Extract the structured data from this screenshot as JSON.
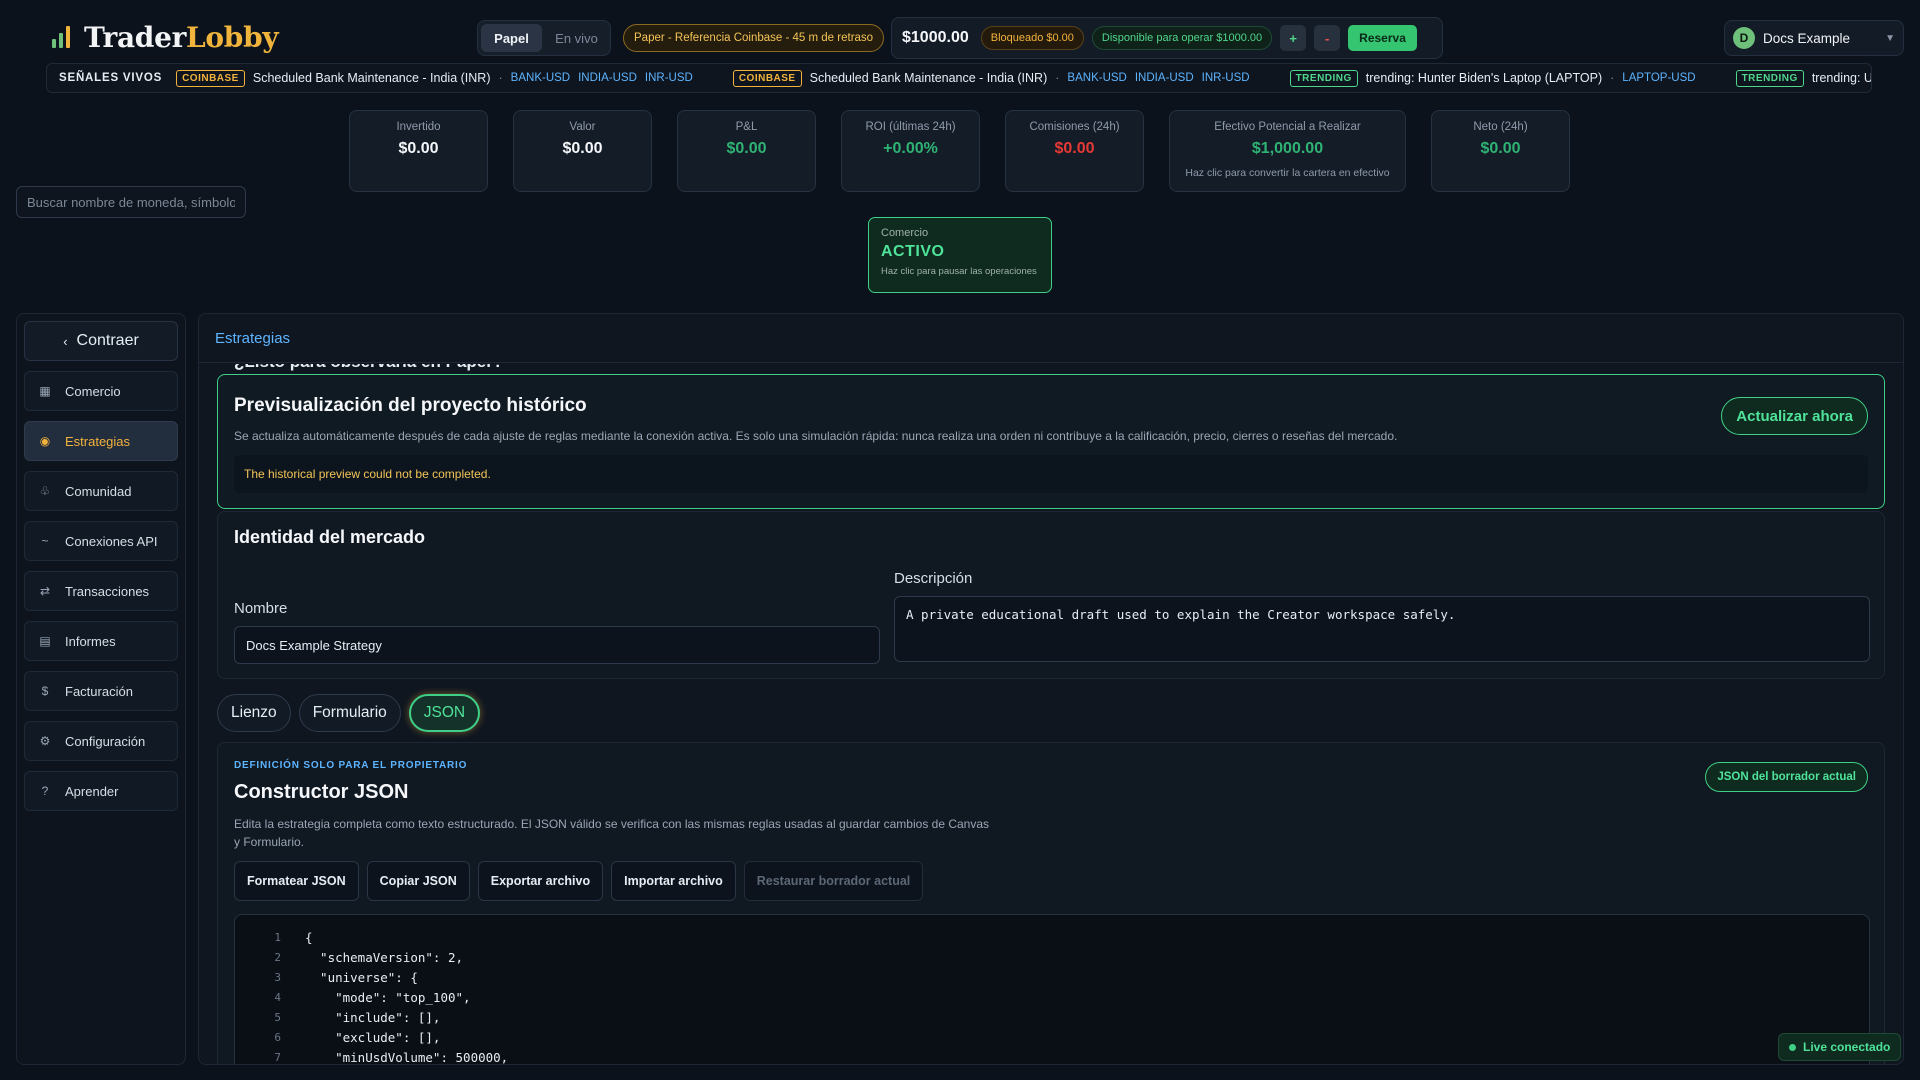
{
  "brand": {
    "name_part1": "Trader",
    "name_part2": "Lobby"
  },
  "header": {
    "mode_paper": "Papel",
    "mode_live": "En vivo",
    "paper_badge": "Paper - Referencia Coinbase - 45 m de retraso",
    "balance": "$1000.00",
    "blocked": "Bloqueado $0.00",
    "available": "Disponible para operar $1000.00",
    "plus": "+",
    "minus": "-",
    "reserve": "Reserva",
    "user_initial": "D",
    "user_name": "Docs Example"
  },
  "ticker": {
    "title": "SEÑALES VIVOS",
    "items": [
      {
        "badge": "COINBASE",
        "text": "Scheduled Bank Maintenance - India (INR)",
        "pairs": [
          "BANK-USD",
          "INDIA-USD",
          "INR-USD"
        ]
      },
      {
        "badge": "COINBASE",
        "text": "Scheduled Bank Maintenance - India (INR)",
        "pairs": [
          "BANK-USD",
          "INDIA-USD",
          "INR-USD"
        ]
      },
      {
        "badge": "TRENDING",
        "text": "trending: Hunter Biden's Laptop (LAPTOP)",
        "pairs": [
          "LAPTOP-USD"
        ]
      },
      {
        "badge": "TRENDING",
        "text": "trending: USELESS STONK (STON",
        "pairs": []
      }
    ]
  },
  "metrics": [
    {
      "label": "Invertido",
      "value": "$0.00",
      "tone": "white"
    },
    {
      "label": "Valor",
      "value": "$0.00",
      "tone": "white"
    },
    {
      "label": "P&L",
      "value": "$0.00",
      "tone": "green"
    },
    {
      "label": "ROI (últimas 24h)",
      "value": "+0.00%",
      "tone": "green"
    },
    {
      "label": "Comisiones (24h)",
      "value": "$0.00",
      "tone": "red"
    },
    {
      "label": "Efectivo Potencial a Realizar",
      "value": "$1,000.00",
      "tone": "green",
      "sub": "Haz clic para convertir la cartera en efectivo"
    },
    {
      "label": "Neto (24h)",
      "value": "$0.00",
      "tone": "green"
    }
  ],
  "search": {
    "placeholder": "Buscar nombre de moneda, símbolo"
  },
  "trading": {
    "label": "Comercio",
    "status": "ACTIVO",
    "hint": "Haz clic para pausar las operaciones"
  },
  "sidebar": {
    "collapse": "Contraer",
    "items": [
      {
        "label": "Comercio",
        "icon": "grid-icon",
        "glyph": "▦"
      },
      {
        "label": "Estrategias",
        "icon": "strategy-icon",
        "glyph": "◉"
      },
      {
        "label": "Comunidad",
        "icon": "community-icon",
        "glyph": "♧"
      },
      {
        "label": "Conexiones API",
        "icon": "api-icon",
        "glyph": "~"
      },
      {
        "label": "Transacciones",
        "icon": "transfer-icon",
        "glyph": "⇄"
      },
      {
        "label": "Informes",
        "icon": "report-icon",
        "glyph": "▤"
      },
      {
        "label": "Facturación",
        "icon": "dollar-icon",
        "glyph": "$"
      },
      {
        "label": "Configuración",
        "icon": "gear-icon",
        "glyph": "⚙"
      },
      {
        "label": "Aprender",
        "icon": "help-icon",
        "glyph": "?"
      }
    ],
    "active_index": 1
  },
  "main": {
    "title": "Estrategias",
    "cut_heading": "¿Listo para observarla en Paper?",
    "preview": {
      "title": "Previsualización del proyecto histórico",
      "desc": "Se actualiza automáticamente después de cada ajuste de reglas mediante la conexión activa. Es solo una simulación rápida: nunca realiza una orden ni contribuye a la calificación, precio, cierres o reseñas del mercado.",
      "error": "The historical preview could not be completed.",
      "refresh": "Actualizar ahora"
    },
    "identity": {
      "title": "Identidad del mercado",
      "name_label": "Nombre",
      "name_value": "Docs Example Strategy",
      "desc_label": "Descripción",
      "desc_value": "A private educational draft used to explain the Creator workspace safely."
    },
    "tabs": [
      "Lienzo",
      "Formulario",
      "JSON"
    ],
    "active_tab": 2,
    "builder": {
      "kicker": "DEFINICIÓN SOLO PARA EL PROPIETARIO",
      "title": "Constructor JSON",
      "desc": "Edita la estrategia completa como texto estructurado. El JSON válido se verifica con las mismas reglas usadas al guardar cambios de Canvas y Formulario.",
      "badge": "JSON del borrador actual",
      "actions": [
        "Formatear JSON",
        "Copiar JSON",
        "Exportar archivo",
        "Importar archivo",
        "Restaurar borrador actual"
      ],
      "code_lines": [
        "{",
        "  \"schemaVersion\": 2,",
        "  \"universe\": {",
        "    \"mode\": \"top_100\",",
        "    \"include\": [],",
        "    \"exclude\": [],",
        "    \"minUsdVolume\": 500000,"
      ]
    }
  },
  "status": {
    "live": "Live conectado"
  }
}
